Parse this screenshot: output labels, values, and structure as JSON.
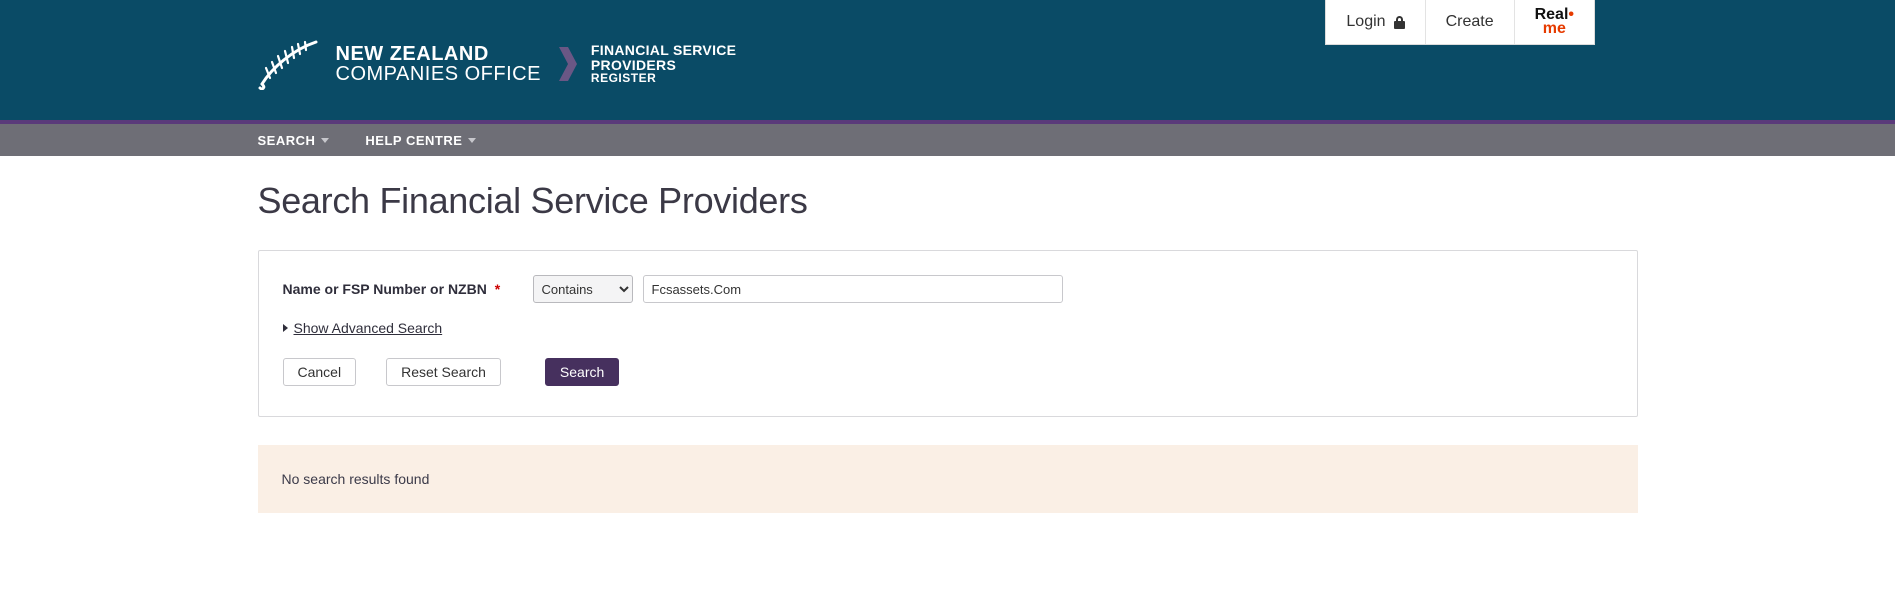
{
  "topright": {
    "login": "Login",
    "create": "Create",
    "realme_top": "Real",
    "realme_bot": "me"
  },
  "brand": {
    "line1": "NEW ZEALAND",
    "line2": "COMPANIES OFFICE"
  },
  "site": {
    "line1": "FINANCIAL SERVICE",
    "line2": "PROVIDERS",
    "line3": "REGISTER"
  },
  "nav": {
    "search": "SEARCH",
    "help": "HELP CENTRE"
  },
  "page": {
    "title": "Search Financial Service Providers"
  },
  "form": {
    "label": "Name or FSP Number or NZBN",
    "required_mark": "*",
    "match_type": "Contains",
    "query_value": "Fcsassets.Com",
    "advanced": "Show Advanced Search",
    "btn_cancel": "Cancel",
    "btn_reset": "Reset Search",
    "btn_search": "Search"
  },
  "results": {
    "none": "No search results found"
  }
}
